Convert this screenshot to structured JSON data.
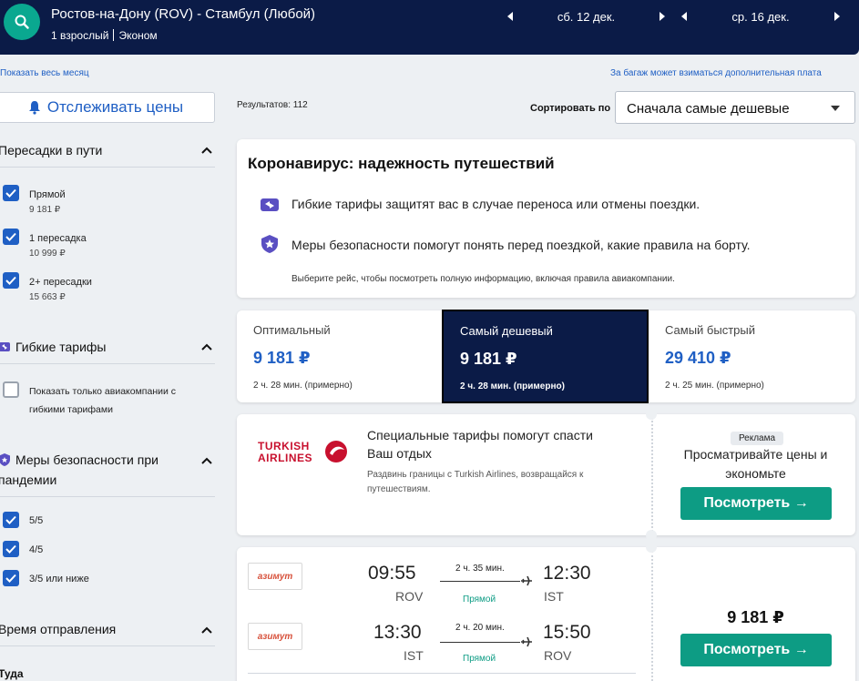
{
  "header": {
    "route": "Ростов-на-Дону (ROV) - Стамбул (Любой)",
    "passengers": "1 взрослый",
    "cabin": "Эконом",
    "depart_date": "сб. 12 дек.",
    "return_date": "ср. 16 дек."
  },
  "links": {
    "show_month": "Показать весь месяц",
    "baggage_note": "За багаж может взиматься дополнительная плата"
  },
  "sidebar": {
    "track_label": "Отслеживать цены",
    "stops": {
      "title": "Пересадки в пути",
      "items": [
        {
          "label": "Прямой",
          "price": "9 181 ₽",
          "checked": true
        },
        {
          "label": "1 пересадка",
          "price": "10 999 ₽",
          "checked": true
        },
        {
          "label": "2+ пересадки",
          "price": "15 663 ₽",
          "checked": true
        }
      ]
    },
    "flex": {
      "title": "Гибкие тарифы",
      "option_line1": "Показать только авиакомпании с",
      "option_line2": "гибкими тарифами",
      "checked": false
    },
    "safety": {
      "title_line1": "Меры безопасности при",
      "title_line2": "пандемии",
      "items": [
        {
          "label": "5/5",
          "checked": true
        },
        {
          "label": "4/5",
          "checked": true
        },
        {
          "label": "3/5 или ниже",
          "checked": true
        }
      ]
    },
    "departure": {
      "title": "Время отправления",
      "sub": "Туда"
    }
  },
  "results": {
    "count_label": "Результатов: 112",
    "sort_label": "Сортировать по",
    "sort_value": "Сначала самые дешевые"
  },
  "covid": {
    "title": "Коронавирус: надежность путешествий",
    "line1": "Гибкие тарифы защитят вас в случае переноса или отмены поездки.",
    "line2": "Меры безопасности помогут понять перед поездкой, какие правила на борту.",
    "note": "Выберите рейс, чтобы посмотреть полную информацию, включая правила авиакомпании."
  },
  "tabs": [
    {
      "title": "Оптимальный",
      "price": "9 181 ₽",
      "duration": "2 ч. 28 мин. (примерно)",
      "selected": false
    },
    {
      "title": "Самый дешевый",
      "price": "9 181 ₽",
      "duration": "2 ч. 28 мин. (примерно)",
      "selected": true
    },
    {
      "title": "Самый быстрый",
      "price": "29 410 ₽",
      "duration": "2 ч. 25 мин. (примерно)",
      "selected": false
    }
  ],
  "ad": {
    "airline_line1": "TURKISH",
    "airline_line2": "AIRLINES",
    "headline_line1": "Специальные тарифы помогут спасти",
    "headline_line2": "Ваш отдых",
    "desc_line1": "Раздвинь границы с Turkish Airlines, возвращайся к",
    "desc_line2": "путешествиям.",
    "badge": "Реклама",
    "cta_line1": "Просматривайте цены и",
    "cta_line2": "экономьте",
    "button": "Посмотреть →"
  },
  "flight": {
    "airline": "азимут",
    "price": "9 181 ₽",
    "button": "Посмотреть →",
    "legs": [
      {
        "dep_time": "09:55",
        "dep_code": "ROV",
        "duration": "2 ч. 35 мин.",
        "stops": "Прямой",
        "arr_time": "12:30",
        "arr_code": "IST"
      },
      {
        "dep_time": "13:30",
        "dep_code": "IST",
        "duration": "2 ч. 20 мин.",
        "stops": "Прямой",
        "arr_time": "15:50",
        "arr_code": "ROV"
      }
    ]
  },
  "colors": {
    "navy": "#0b1b47",
    "accent_blue": "#1f5fc4",
    "green": "#0d9c84",
    "turkish_red": "#c8102e"
  }
}
